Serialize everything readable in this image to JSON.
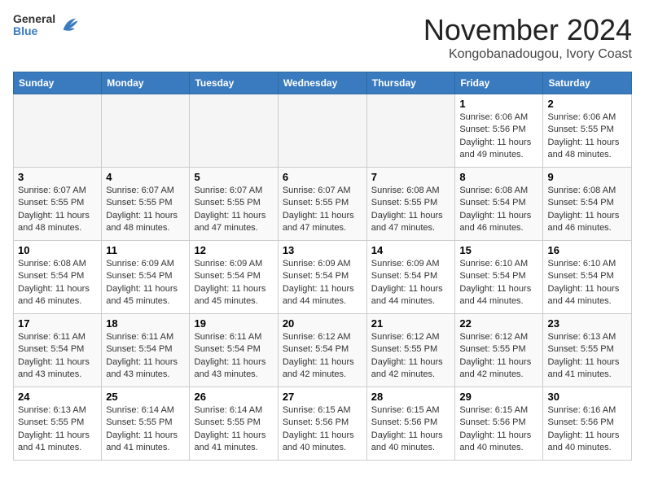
{
  "header": {
    "logo": {
      "general": "General",
      "blue": "Blue"
    },
    "title": "November 2024",
    "subtitle": "Kongobanadougou, Ivory Coast"
  },
  "calendar": {
    "weekdays": [
      "Sunday",
      "Monday",
      "Tuesday",
      "Wednesday",
      "Thursday",
      "Friday",
      "Saturday"
    ],
    "weeks": [
      [
        {
          "day": "",
          "info": ""
        },
        {
          "day": "",
          "info": ""
        },
        {
          "day": "",
          "info": ""
        },
        {
          "day": "",
          "info": ""
        },
        {
          "day": "",
          "info": ""
        },
        {
          "day": "1",
          "info": "Sunrise: 6:06 AM\nSunset: 5:56 PM\nDaylight: 11 hours\nand 49 minutes."
        },
        {
          "day": "2",
          "info": "Sunrise: 6:06 AM\nSunset: 5:55 PM\nDaylight: 11 hours\nand 48 minutes."
        }
      ],
      [
        {
          "day": "3",
          "info": "Sunrise: 6:07 AM\nSunset: 5:55 PM\nDaylight: 11 hours\nand 48 minutes."
        },
        {
          "day": "4",
          "info": "Sunrise: 6:07 AM\nSunset: 5:55 PM\nDaylight: 11 hours\nand 48 minutes."
        },
        {
          "day": "5",
          "info": "Sunrise: 6:07 AM\nSunset: 5:55 PM\nDaylight: 11 hours\nand 47 minutes."
        },
        {
          "day": "6",
          "info": "Sunrise: 6:07 AM\nSunset: 5:55 PM\nDaylight: 11 hours\nand 47 minutes."
        },
        {
          "day": "7",
          "info": "Sunrise: 6:08 AM\nSunset: 5:55 PM\nDaylight: 11 hours\nand 47 minutes."
        },
        {
          "day": "8",
          "info": "Sunrise: 6:08 AM\nSunset: 5:54 PM\nDaylight: 11 hours\nand 46 minutes."
        },
        {
          "day": "9",
          "info": "Sunrise: 6:08 AM\nSunset: 5:54 PM\nDaylight: 11 hours\nand 46 minutes."
        }
      ],
      [
        {
          "day": "10",
          "info": "Sunrise: 6:08 AM\nSunset: 5:54 PM\nDaylight: 11 hours\nand 46 minutes."
        },
        {
          "day": "11",
          "info": "Sunrise: 6:09 AM\nSunset: 5:54 PM\nDaylight: 11 hours\nand 45 minutes."
        },
        {
          "day": "12",
          "info": "Sunrise: 6:09 AM\nSunset: 5:54 PM\nDaylight: 11 hours\nand 45 minutes."
        },
        {
          "day": "13",
          "info": "Sunrise: 6:09 AM\nSunset: 5:54 PM\nDaylight: 11 hours\nand 44 minutes."
        },
        {
          "day": "14",
          "info": "Sunrise: 6:09 AM\nSunset: 5:54 PM\nDaylight: 11 hours\nand 44 minutes."
        },
        {
          "day": "15",
          "info": "Sunrise: 6:10 AM\nSunset: 5:54 PM\nDaylight: 11 hours\nand 44 minutes."
        },
        {
          "day": "16",
          "info": "Sunrise: 6:10 AM\nSunset: 5:54 PM\nDaylight: 11 hours\nand 44 minutes."
        }
      ],
      [
        {
          "day": "17",
          "info": "Sunrise: 6:11 AM\nSunset: 5:54 PM\nDaylight: 11 hours\nand 43 minutes."
        },
        {
          "day": "18",
          "info": "Sunrise: 6:11 AM\nSunset: 5:54 PM\nDaylight: 11 hours\nand 43 minutes."
        },
        {
          "day": "19",
          "info": "Sunrise: 6:11 AM\nSunset: 5:54 PM\nDaylight: 11 hours\nand 43 minutes."
        },
        {
          "day": "20",
          "info": "Sunrise: 6:12 AM\nSunset: 5:54 PM\nDaylight: 11 hours\nand 42 minutes."
        },
        {
          "day": "21",
          "info": "Sunrise: 6:12 AM\nSunset: 5:55 PM\nDaylight: 11 hours\nand 42 minutes."
        },
        {
          "day": "22",
          "info": "Sunrise: 6:12 AM\nSunset: 5:55 PM\nDaylight: 11 hours\nand 42 minutes."
        },
        {
          "day": "23",
          "info": "Sunrise: 6:13 AM\nSunset: 5:55 PM\nDaylight: 11 hours\nand 41 minutes."
        }
      ],
      [
        {
          "day": "24",
          "info": "Sunrise: 6:13 AM\nSunset: 5:55 PM\nDaylight: 11 hours\nand 41 minutes."
        },
        {
          "day": "25",
          "info": "Sunrise: 6:14 AM\nSunset: 5:55 PM\nDaylight: 11 hours\nand 41 minutes."
        },
        {
          "day": "26",
          "info": "Sunrise: 6:14 AM\nSunset: 5:55 PM\nDaylight: 11 hours\nand 41 minutes."
        },
        {
          "day": "27",
          "info": "Sunrise: 6:15 AM\nSunset: 5:56 PM\nDaylight: 11 hours\nand 40 minutes."
        },
        {
          "day": "28",
          "info": "Sunrise: 6:15 AM\nSunset: 5:56 PM\nDaylight: 11 hours\nand 40 minutes."
        },
        {
          "day": "29",
          "info": "Sunrise: 6:15 AM\nSunset: 5:56 PM\nDaylight: 11 hours\nand 40 minutes."
        },
        {
          "day": "30",
          "info": "Sunrise: 6:16 AM\nSunset: 5:56 PM\nDaylight: 11 hours\nand 40 minutes."
        }
      ]
    ]
  }
}
